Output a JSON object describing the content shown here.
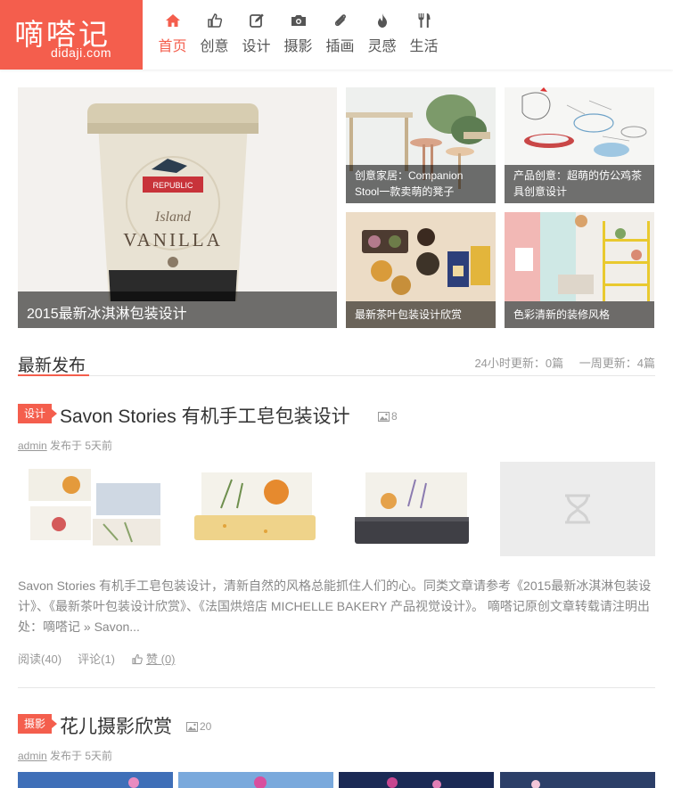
{
  "logo": {
    "main": "嘀嗒记",
    "sub": "didaji.com"
  },
  "nav": [
    {
      "label": "首页",
      "icon": "home-icon",
      "active": true
    },
    {
      "label": "创意",
      "icon": "thumbs-up-icon"
    },
    {
      "label": "设计",
      "icon": "edit-icon"
    },
    {
      "label": "摄影",
      "icon": "camera-icon"
    },
    {
      "label": "插画",
      "icon": "paperclip-icon"
    },
    {
      "label": "灵感",
      "icon": "flame-icon"
    },
    {
      "label": "生活",
      "icon": "fork-knife-icon"
    }
  ],
  "slider": {
    "hero": {
      "caption": "2015最新冰淇淋包装设计",
      "label_top": "REPUBLIC",
      "label_script": "Island",
      "label_main": "VANILLA"
    },
    "tiles": [
      {
        "caption": "创意家居：Companion Stool一款卖萌的凳子"
      },
      {
        "caption": "产品创意：超萌的仿公鸡茶具创意设计"
      },
      {
        "caption": "最新茶叶包装设计欣赏"
      },
      {
        "caption": "色彩清新的装修风格"
      }
    ]
  },
  "section": {
    "title": "最新发布",
    "stat_24h": "24小时更新：0篇",
    "stat_week": "一周更新：4篇"
  },
  "posts": [
    {
      "category": "设计",
      "title": "Savon Stories 有机手工皂包装设计",
      "image_count": "8",
      "author": "admin",
      "meta": "发布于 5天前",
      "excerpt": "Savon Stories 有机手工皂包装设计，清新自然的风格总能抓住人们的心。同类文章请参考《2015最新冰淇淋包装设计》、《最新茶叶包装设计欣赏》、《法国烘焙店 MICHELLE BAKERY 产品视觉设计》。 嘀嗒记原创文章转载请注明出处：嘀嗒记 » Savon...",
      "reads": "阅读(40)",
      "comments": "评论(1)",
      "likes": "赞 (0)"
    },
    {
      "category": "摄影",
      "title": "花儿摄影欣赏",
      "image_count": "20",
      "author": "admin",
      "meta": "发布于 5天前"
    }
  ],
  "colors": {
    "accent": "#f45e4d"
  }
}
